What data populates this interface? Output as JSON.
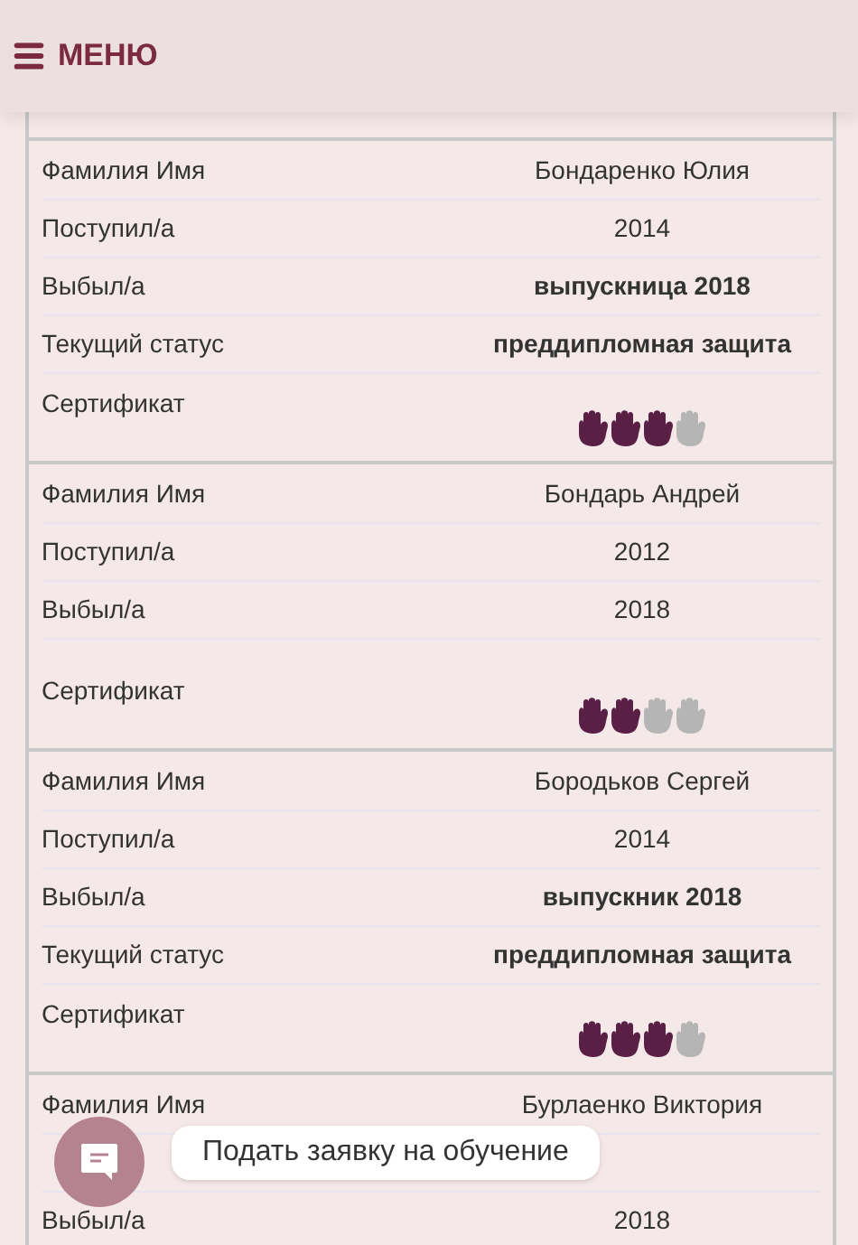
{
  "header": {
    "menu_label": "МЕНЮ"
  },
  "records": [
    {
      "rows": [
        {
          "kind": "text",
          "label": "Фамилия Имя",
          "value": "Бондаренко Юлия"
        },
        {
          "kind": "text",
          "label": "Поступил/а",
          "value": "2014"
        },
        {
          "kind": "bold",
          "label": "Выбыл/а",
          "value": "выпускница 2018"
        },
        {
          "kind": "bold",
          "label": "Текущий статус",
          "value": "преддипломная защита"
        },
        {
          "kind": "certificate",
          "label": "Сертификат",
          "stars": 3
        }
      ]
    },
    {
      "rows": [
        {
          "kind": "text",
          "label": "Фамилия Имя",
          "value": "Бондарь Андрей"
        },
        {
          "kind": "text",
          "label": "Поступил/а",
          "value": "2012"
        },
        {
          "kind": "text",
          "label": "Выбыл/а",
          "value": "2018"
        },
        {
          "kind": "empty"
        },
        {
          "kind": "certificate",
          "label": "Сертификат",
          "stars": 2
        }
      ]
    },
    {
      "rows": [
        {
          "kind": "text",
          "label": "Фамилия Имя",
          "value": "Бородьков Сергей"
        },
        {
          "kind": "text",
          "label": "Поступил/а",
          "value": "2014"
        },
        {
          "kind": "bold",
          "label": "Выбыл/а",
          "value": "выпускник 2018"
        },
        {
          "kind": "bold",
          "label": "Текущий статус",
          "value": "преддипломная защита"
        },
        {
          "kind": "certificate",
          "label": "Сертификат",
          "stars": 3
        }
      ]
    },
    {
      "rows": [
        {
          "kind": "text",
          "label": "Фамилия Имя",
          "value": "Бурлаенко Виктория"
        },
        {
          "kind": "covered"
        },
        {
          "kind": "text",
          "label": "Выбыл/а",
          "value": "2018"
        }
      ]
    }
  ],
  "chat": {
    "label": "Подать заявку на обучение"
  }
}
